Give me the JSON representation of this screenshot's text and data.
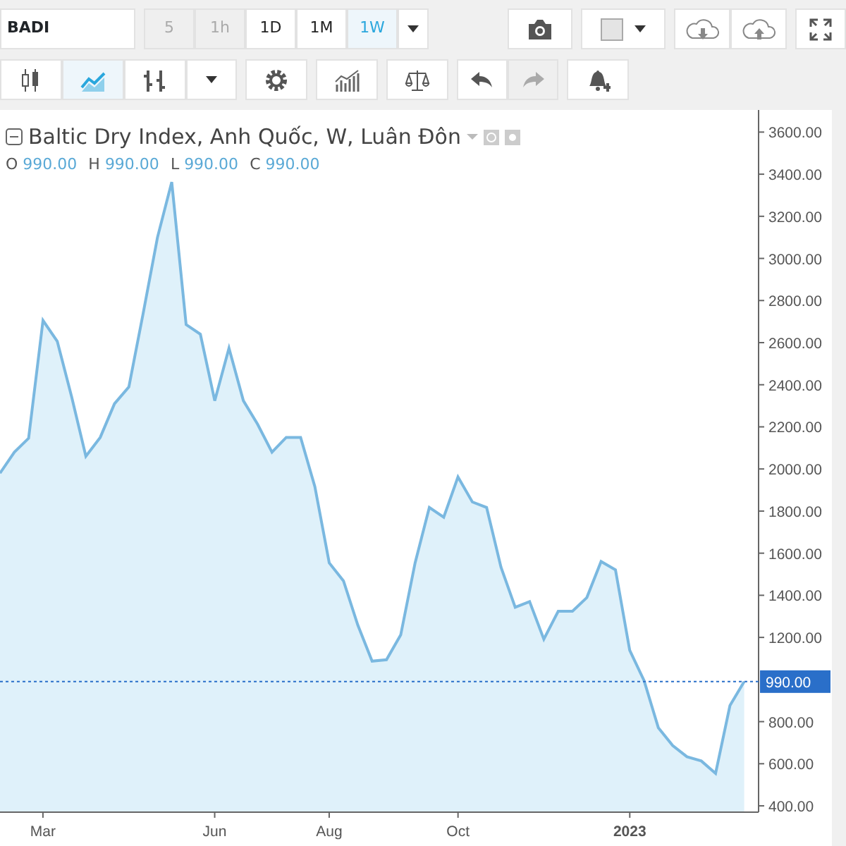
{
  "toolbar": {
    "symbol": "BADI",
    "intervals": [
      {
        "label": "5",
        "selected": false,
        "disabled": true
      },
      {
        "label": "1h",
        "selected": false,
        "disabled": true
      },
      {
        "label": "1D",
        "selected": false,
        "disabled": false
      },
      {
        "label": "1M",
        "selected": false,
        "disabled": false
      },
      {
        "label": "1W",
        "selected": true,
        "disabled": false
      }
    ],
    "tools": [
      {
        "kind": "candles",
        "selected": false,
        "disabled": false
      },
      {
        "kind": "line",
        "selected": true,
        "disabled": false
      },
      {
        "kind": "bars",
        "selected": false,
        "disabled": false
      },
      {
        "kind": "settings",
        "selected": false,
        "disabled": false
      },
      {
        "kind": "indicators",
        "selected": false,
        "disabled": false
      },
      {
        "kind": "compare",
        "selected": false,
        "disabled": false
      },
      {
        "kind": "undo",
        "selected": false,
        "disabled": false
      },
      {
        "kind": "redo",
        "selected": false,
        "disabled": true
      },
      {
        "kind": "alert",
        "selected": false,
        "disabled": false
      }
    ]
  },
  "legend": {
    "title": "Baltic Dry Index, Anh Quốc, W, Luân Đôn",
    "ohlc": [
      {
        "label": "O",
        "value": "990.00"
      },
      {
        "label": "H",
        "value": "990.00"
      },
      {
        "label": "L",
        "value": "990.00"
      },
      {
        "label": "C",
        "value": "990.00"
      }
    ]
  },
  "chart": {
    "chart_data": {
      "type": "area",
      "categories": [
        null,
        null,
        null,
        "Mar",
        null,
        null,
        null,
        null,
        null,
        null,
        null,
        null,
        null,
        null,
        null,
        "Jun",
        null,
        null,
        null,
        null,
        null,
        null,
        null,
        "Aug",
        null,
        null,
        null,
        null,
        null,
        null,
        null,
        null,
        "Oct",
        null,
        null,
        null,
        null,
        null,
        null,
        null,
        null,
        null,
        null,
        null,
        "2023",
        null,
        null,
        null,
        null,
        null,
        null,
        null,
        null
      ],
      "series": [
        {
          "color": "#7ab8e0",
          "values": [
            1980,
            2080,
            2146,
            2705,
            2607,
            2343,
            2060,
            2150,
            2310,
            2390,
            2738,
            3100,
            3363,
            2686,
            2640,
            2324,
            2574,
            2324,
            2212,
            2080,
            2150,
            2150,
            1916,
            1554,
            1468,
            1258,
            1087,
            1094,
            1212,
            1554,
            1817,
            1771,
            1962,
            1843,
            1817,
            1534,
            1343,
            1370,
            1192,
            1324,
            1324,
            1389,
            1561,
            1521,
            1139,
            995,
            771,
            686,
            633,
            613,
            554,
            876,
            990
          ]
        }
      ],
      "ylim": [
        370,
        3705
      ],
      "yticks": [
        {
          "value": 3600,
          "label": "3600.00"
        },
        {
          "value": 3400,
          "label": "3400.00"
        },
        {
          "value": 3200,
          "label": "3200.00"
        },
        {
          "value": 3000,
          "label": "3000.00"
        },
        {
          "value": 2800,
          "label": "2800.00"
        },
        {
          "value": 2600,
          "label": "2600.00"
        },
        {
          "value": 2400,
          "label": "2400.00"
        },
        {
          "value": 2200,
          "label": "2200.00"
        },
        {
          "value": 2000,
          "label": "2000.00"
        },
        {
          "value": 1800,
          "label": "1800.00"
        },
        {
          "value": 1600,
          "label": "1600.00"
        },
        {
          "value": 1400,
          "label": "1400.00"
        },
        {
          "value": 1200,
          "label": "1200.00"
        },
        {
          "value": 800,
          "label": "800.00"
        },
        {
          "value": 600,
          "label": "600.00"
        },
        {
          "value": 400,
          "label": "400.00"
        }
      ],
      "ref_lines": [
        {
          "axis": "y",
          "value": 990,
          "label": "990.00"
        }
      ]
    }
  }
}
